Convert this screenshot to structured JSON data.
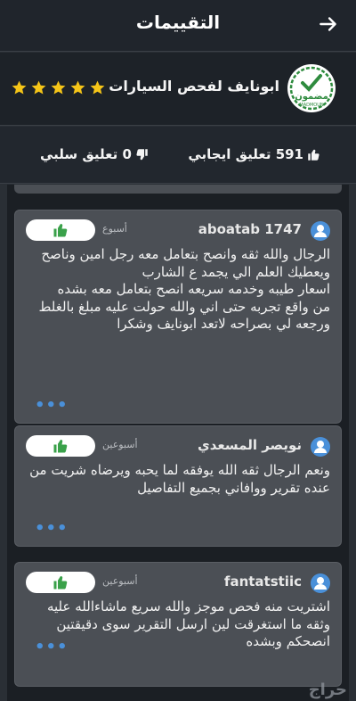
{
  "header": {
    "title": "التقييمات"
  },
  "store": {
    "name": "ابونايف لفحص السيارات",
    "badge_text": "مضمون",
    "badge_subtext": "MADMOUN",
    "rating": 5
  },
  "counts": {
    "positive": "591 تعليق ايجابي",
    "negative": "0 تعليق سلبي"
  },
  "reviews": [
    {
      "user": "aboatab 1747",
      "time": "أسبوع",
      "text": "الرجال والله ثقه وانصح بتعامل معه رجل امين وناصح ويعطيك العلم الي يجمد ع الشارب\nاسعار طيبه وخدمه سريعه انصح بتعامل معه بشده\nمن واقع تجربه حتى اني والله حولت عليه مبلغ بالغلط ورجعه لي بصراحه لاتعد ابونايف وشكرا"
    },
    {
      "user": "نويصر المسعدي",
      "time": "أسبوعين",
      "text": "ونعم الرجال ثقه الله يوفقه لما يحبه ويرضاه شريت من عنده تقرير ووافاني بجميع التفاصيل"
    },
    {
      "user": "fantatstiic",
      "time": "أسبوعين",
      "text": "اشتريت منه فحص موجز والله سريع ماشاءالله عليه وثقه ما استغرقت لين ارسل التقرير سوى دقيقتين   انصحكم وبشده"
    }
  ],
  "more_label": "•••",
  "watermark": "حراج"
}
